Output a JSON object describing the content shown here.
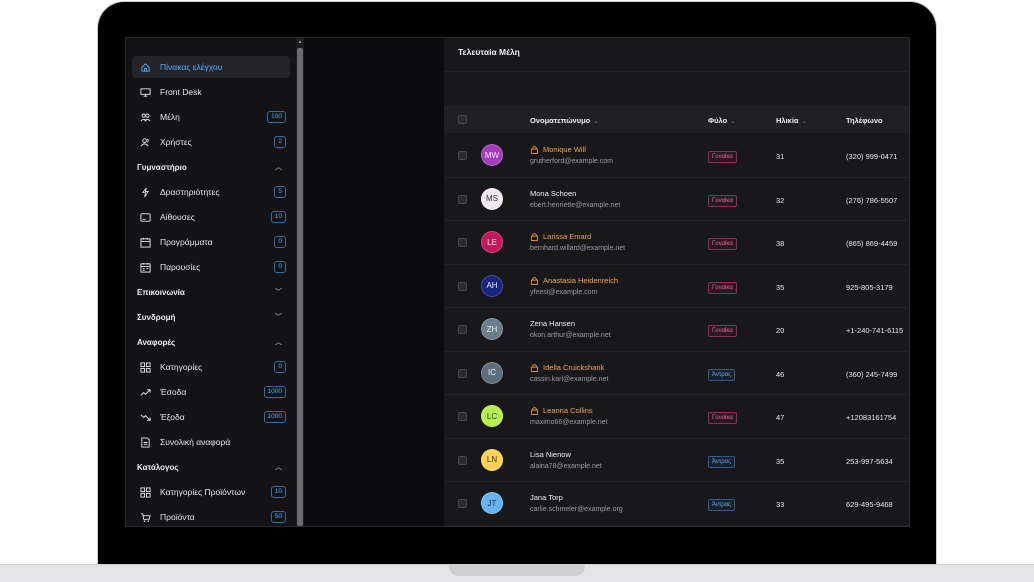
{
  "sidebar": {
    "items": [
      {
        "type": "item",
        "label": "Πίνακας ελέγχου",
        "icon": "home-icon",
        "active": true,
        "badge": null
      },
      {
        "type": "item",
        "label": "Front Desk",
        "icon": "monitor-icon",
        "badge": null
      },
      {
        "type": "item",
        "label": "Μέλη",
        "icon": "members-icon",
        "badge": "100"
      },
      {
        "type": "item",
        "label": "Χρήστες",
        "icon": "users-icon",
        "badge": "2"
      },
      {
        "type": "section",
        "label": "Γυμναστήριο",
        "expanded": true
      },
      {
        "type": "item",
        "label": "Δραστηριότητες",
        "icon": "bolt-icon",
        "badge": "5"
      },
      {
        "type": "item",
        "label": "Αίθουσες",
        "icon": "room-icon",
        "badge": "10"
      },
      {
        "type": "item",
        "label": "Προγράμματα",
        "icon": "calendar-icon",
        "badge": "0"
      },
      {
        "type": "item",
        "label": "Παρουσίες",
        "icon": "attendance-icon",
        "badge": "0"
      },
      {
        "type": "section",
        "label": "Επικοινωνία",
        "expanded": false
      },
      {
        "type": "section",
        "label": "Συνδρομή",
        "expanded": false
      },
      {
        "type": "section",
        "label": "Αναφορές",
        "expanded": true
      },
      {
        "type": "item",
        "label": "Κατηγορίες",
        "icon": "grid-icon",
        "badge": "0"
      },
      {
        "type": "item",
        "label": "Έσοδα",
        "icon": "trend-up-icon",
        "badge": "1000"
      },
      {
        "type": "item",
        "label": "Έξοδα",
        "icon": "trend-down-icon",
        "badge": "1000"
      },
      {
        "type": "item",
        "label": "Συνολική αναφορά",
        "icon": "report-icon",
        "badge": null
      },
      {
        "type": "section",
        "label": "Κατάλογος",
        "expanded": true
      },
      {
        "type": "item",
        "label": "Κατηγορίες Προϊόντων",
        "icon": "grid-icon",
        "badge": "10"
      },
      {
        "type": "item",
        "label": "Προϊόντα",
        "icon": "cart-icon",
        "badge": "50"
      }
    ]
  },
  "main": {
    "title": "Τελευταία Μέλη",
    "columns": {
      "name": "Ονοματεπώνυμο",
      "gender": "Φύλο",
      "age": "Ηλικία",
      "phone": "Τηλέφωνο"
    },
    "rows": [
      {
        "initials": "MW",
        "avatar_color": "#a53bbf",
        "name": "Monique Will",
        "email": "grutherford@example.com",
        "locked": true,
        "gender": "Γυναίκα",
        "g": "f",
        "age": "31",
        "phone": "(320) 999-0471"
      },
      {
        "initials": "MS",
        "avatar_color": "#f3e9f5",
        "name": "Mona Schoen",
        "email": "ebert.henriette@example.net",
        "locked": false,
        "gender": "Γυναίκα",
        "g": "f",
        "age": "32",
        "phone": "(276) 786-5507"
      },
      {
        "initials": "LE",
        "avatar_color": "#c2185b",
        "name": "Larissa Emard",
        "email": "bernhard.willard@example.net",
        "locked": true,
        "gender": "Γυναίκα",
        "g": "f",
        "age": "38",
        "phone": "(865) 869-4459"
      },
      {
        "initials": "AH",
        "avatar_color": "#1a237e",
        "name": "Anastasia Heidenreich",
        "email": "yfeest@example.com",
        "locked": true,
        "gender": "Γυναίκα",
        "g": "f",
        "age": "35",
        "phone": "925-805-3179"
      },
      {
        "initials": "ZH",
        "avatar_color": "#6b7c8a",
        "name": "Zena Hansen",
        "email": "okon.arthur@example.net",
        "locked": false,
        "gender": "Γυναίκα",
        "g": "f",
        "age": "20",
        "phone": "+1-240-741-6115"
      },
      {
        "initials": "IC",
        "avatar_color": "#5d6f7c",
        "name": "Idella Cruickshank",
        "email": "cassin.karl@example.net",
        "locked": true,
        "gender": "Άντρας",
        "g": "m",
        "age": "46",
        "phone": "(360) 245-7499"
      },
      {
        "initials": "LC",
        "avatar_color": "#b6f04a",
        "name": "Leanna Collins",
        "email": "maximo66@example.net",
        "locked": true,
        "gender": "Γυναίκα",
        "g": "f",
        "age": "47",
        "phone": "+12083161754"
      },
      {
        "initials": "LN",
        "avatar_color": "#ffd54f",
        "name": "Lisa Nienow",
        "email": "alaina78@example.net",
        "locked": false,
        "gender": "Άντρας",
        "g": "m",
        "age": "35",
        "phone": "253-997-5634"
      },
      {
        "initials": "JT",
        "avatar_color": "#64b5f6",
        "name": "Jana Torp",
        "email": "carlie.schmeler@example.org",
        "locked": false,
        "gender": "Άντρας",
        "g": "m",
        "age": "33",
        "phone": "629-495-9468"
      }
    ]
  },
  "colors": {
    "accent": "#4fb1ff",
    "locked_name": "#f4a640",
    "female_badge": "#ea6a95",
    "male_badge": "#6aa9f0"
  }
}
